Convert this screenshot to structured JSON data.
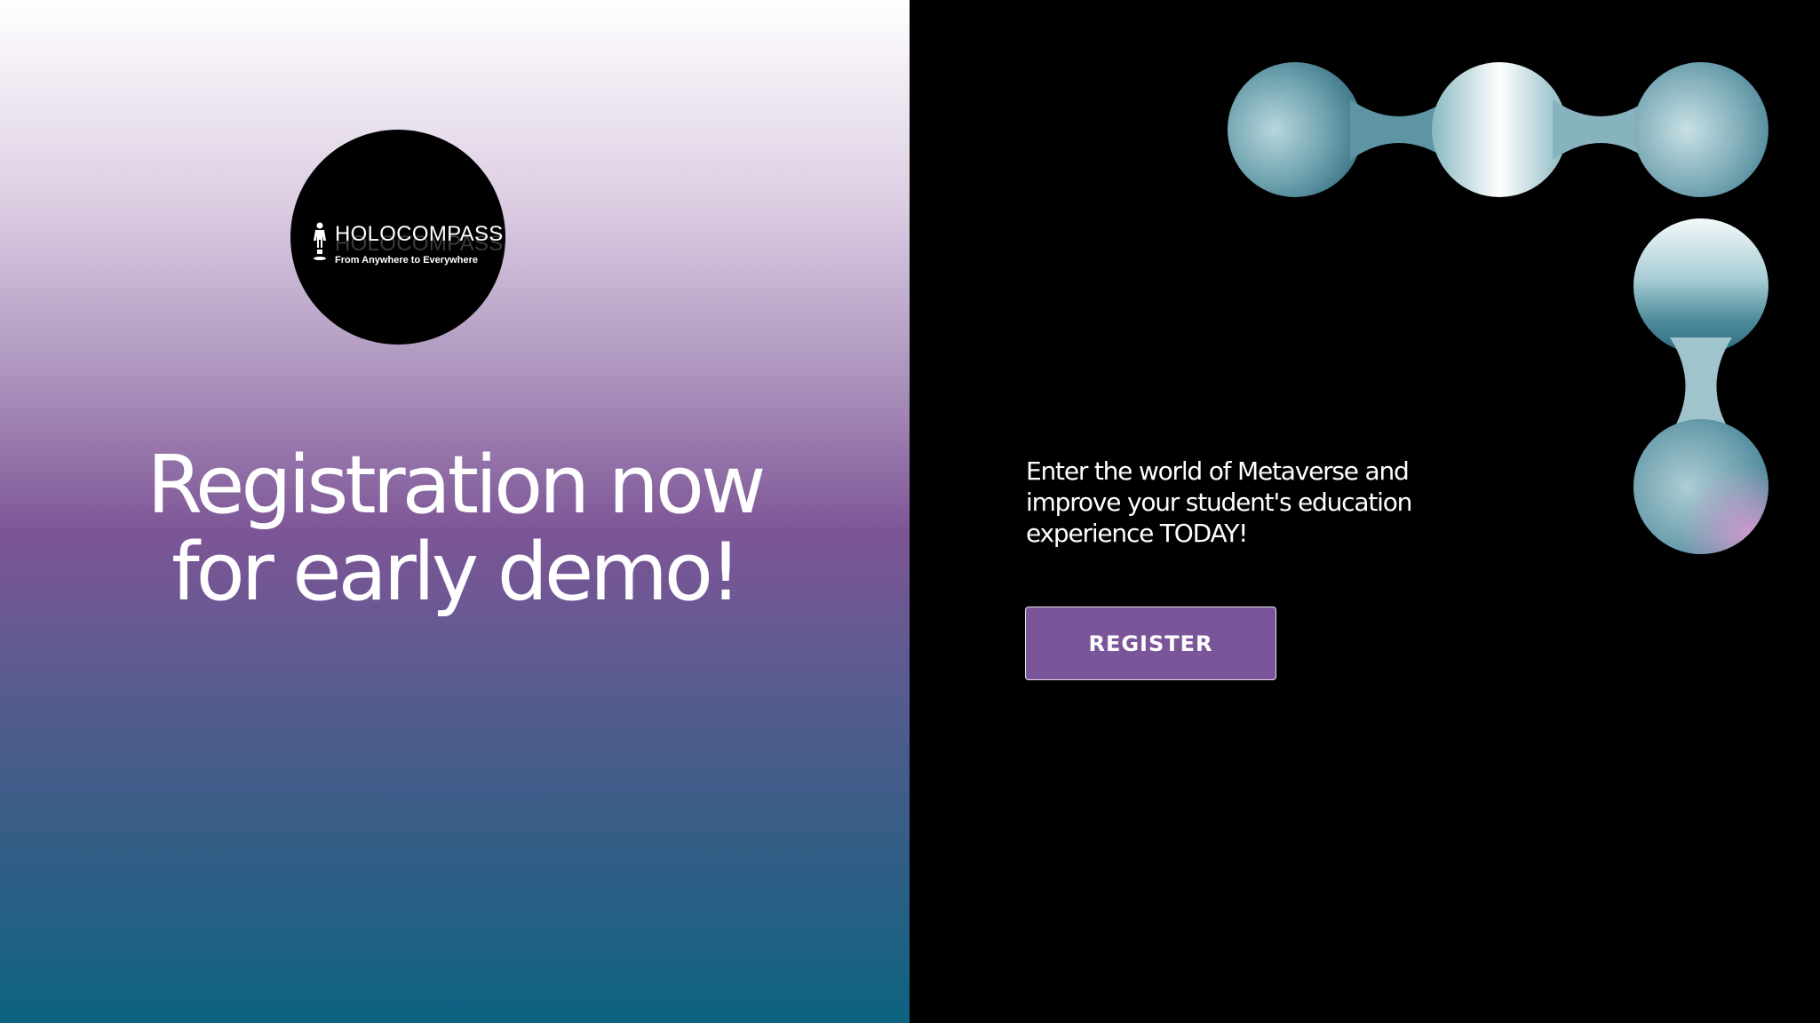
{
  "logo": {
    "name": "HOLOCOMPASS",
    "tagline": "From Anywhere to Everywhere"
  },
  "headline": {
    "line1": "Registration now",
    "line2": "for early demo!"
  },
  "body": {
    "line1": "Enter the world of Metaverse and",
    "line2": "improve your student's education",
    "line3": "experience TODAY!"
  },
  "cta": {
    "label": "REGISTER"
  },
  "colors": {
    "button_bg": "#7b5599",
    "accent_teal": "#4a8a9a",
    "accent_pink": "#c98ac8"
  }
}
